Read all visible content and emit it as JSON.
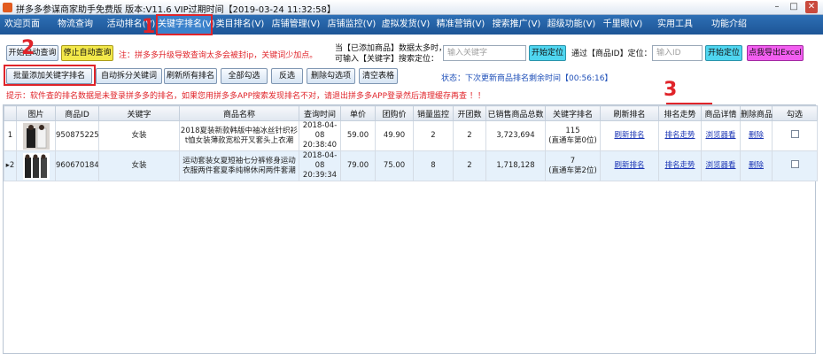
{
  "window": {
    "title": "拼多多参谋商家助手免费版 版本:V11.6 VIP过期时间【2019-03-24 11:32:58】"
  },
  "menu": [
    {
      "label": "欢迎页面"
    },
    {
      "label": "物流查询"
    },
    {
      "label": "活动排名(V)"
    },
    {
      "label": "关键字排名(V)"
    },
    {
      "label": "类目排名(V)"
    },
    {
      "label": "店铺管理(V)"
    },
    {
      "label": "店铺监控(V)"
    },
    {
      "label": "虚拟发货(V)"
    },
    {
      "label": "精准营销(V)"
    },
    {
      "label": "搜索推广(V)"
    },
    {
      "label": "超级功能(V)"
    },
    {
      "label": "千里眼(V)"
    },
    {
      "label": "实用工具"
    },
    {
      "label": "功能介绍"
    }
  ],
  "toolbar": {
    "start_auto": "开始自动查询",
    "stop_auto": "停止自动查询",
    "warning": "注：拼多多升级导致查询太多会被封ip，关键词少加点。",
    "added_note_line1": "当【已添加商品】数据太多时，",
    "added_note_line2": "可输入【关键字】搜索定位：",
    "keyword_placeholder": "输入关键字",
    "locate_btn1": "开始定位",
    "id_locate_label": "通过【商品ID】定位：",
    "id_placeholder": "输入ID",
    "locate_btn2": "开始定位",
    "export_btn": "点我导出Excel",
    "batch_add": "批量添加关键字排名",
    "auto_split": "自动拆分关键词",
    "refresh_all": "刷新所有排名",
    "select_all": "全部勾选",
    "invert": "反选",
    "delete_checked": "删除勾选项",
    "clear_table": "清空表格",
    "status": "状态：下次更新商品排名剩余时间【00:56:16】",
    "tip": "提示：软件查的排名数据是未登录拼多多的排名，如果您用拼多多APP搜索发现排名不对，请退出拼多多APP登录然后清理缓存再查 ！！"
  },
  "annotations": [
    "1",
    "2",
    "3"
  ],
  "table": {
    "headers": [
      "",
      "图片",
      "商品ID",
      "关键字",
      "商品名称",
      "查询时间",
      "单价",
      "团购价",
      "销量监控",
      "开团数",
      "已销售商品总数",
      "关键字排名",
      "刷新排名",
      "排名走势",
      "商品详情",
      "删除商品",
      "勾选"
    ],
    "rows": [
      {
        "index": "1",
        "id": "950875225",
        "keyword": "女装",
        "name": "2018夏装新款韩版中袖冰丝针织衫t恤女装薄款宽松开叉套头上衣潮",
        "date": "2018-04-08",
        "time": "20:38:40",
        "price": "59.00",
        "group_price": "49.90",
        "sales_monitor": "2",
        "groups": "2",
        "total_sold": "3,723,694",
        "rank": "115",
        "rank_note": "(直通车第0位)",
        "refresh": "刷新排名",
        "trend": "排名走势",
        "detail": "浏览器看",
        "delete": "删除"
      },
      {
        "index": "2",
        "id": "960670184",
        "keyword": "女装",
        "name": "运动套装女夏短袖七分裤修身运动衣服两件套夏季纯棉休闲两件套潮",
        "date": "2018-04-08",
        "time": "20:39:34",
        "price": "79.00",
        "group_price": "75.00",
        "sales_monitor": "8",
        "groups": "2",
        "total_sold": "1,718,128",
        "rank": "7",
        "rank_note": "(直通车第2位)",
        "refresh": "刷新排名",
        "trend": "排名走势",
        "detail": "浏览器看",
        "delete": "删除"
      }
    ]
  },
  "colors": {
    "menubar": "#1d5596",
    "annotation": "#e0242a",
    "link": "#1b35b5",
    "warning": "#e0242a"
  }
}
